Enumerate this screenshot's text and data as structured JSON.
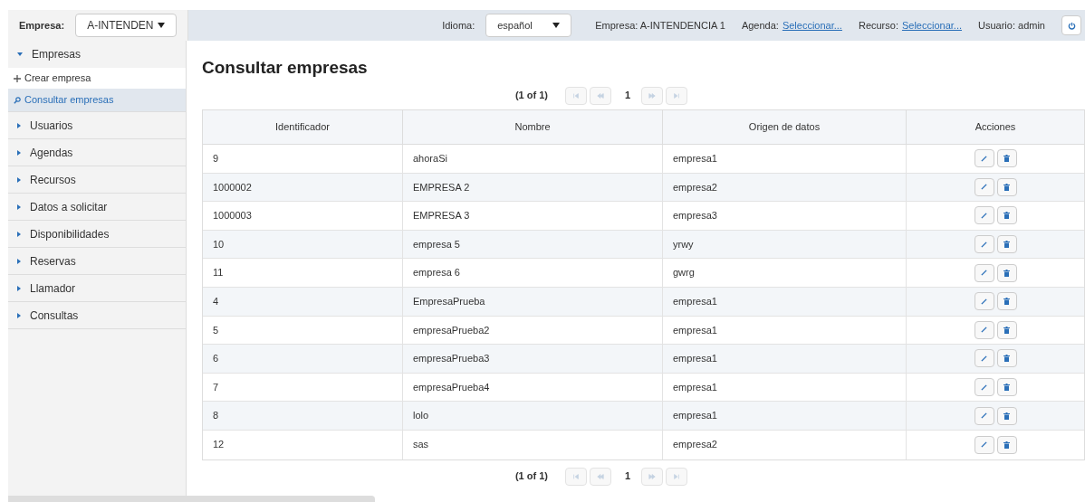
{
  "topbar": {
    "empresa_label": "Empresa:",
    "empresa_value": "A-INTENDEN",
    "idioma_label": "Idioma:",
    "idioma_value": "español",
    "empresa_info": "Empresa: A-INTENDENCIA 1",
    "agenda_label": "Agenda:",
    "agenda_link": "Seleccionar...",
    "recurso_label": "Recurso:",
    "recurso_link": "Seleccionar...",
    "usuario": "Usuario: admin"
  },
  "sidebar": {
    "items": [
      {
        "label": "Empresas",
        "expanded": true,
        "children": [
          {
            "label": "Crear empresa",
            "kind": "create",
            "selected": false
          },
          {
            "label": "Consultar empresas",
            "kind": "search",
            "selected": true
          }
        ]
      },
      {
        "label": "Usuarios",
        "expanded": false
      },
      {
        "label": "Agendas",
        "expanded": false
      },
      {
        "label": "Recursos",
        "expanded": false
      },
      {
        "label": "Datos a solicitar",
        "expanded": false
      },
      {
        "label": "Disponibilidades",
        "expanded": false
      },
      {
        "label": "Reservas",
        "expanded": false
      },
      {
        "label": "Llamador",
        "expanded": false
      },
      {
        "label": "Consultas",
        "expanded": false
      }
    ]
  },
  "page_title": "Consultar empresas",
  "paginators": [
    {
      "summary": "(1 of 1)",
      "page": "1"
    },
    {
      "summary": "(1 of 1)",
      "page": "1"
    }
  ],
  "table": {
    "columns": [
      "Identificador",
      "Nombre",
      "Origen de datos",
      "Acciones"
    ],
    "rows": [
      [
        "9",
        "ahoraSi",
        "empresa1"
      ],
      [
        "1000002",
        "EMPRESA 2",
        "empresa2"
      ],
      [
        "1000003",
        "EMPRESA 3",
        "empresa3"
      ],
      [
        "10",
        "empresa 5",
        "yrwy"
      ],
      [
        "11",
        "empresa 6",
        "gwrg"
      ],
      [
        "4",
        "EmpresaPrueba",
        "empresa1"
      ],
      [
        "5",
        "empresaPrueba2",
        "empresa1"
      ],
      [
        "6",
        "empresaPrueba3",
        "empresa1"
      ],
      [
        "7",
        "empresaPrueba4",
        "empresa1"
      ],
      [
        "8",
        "lolo",
        "empresa1"
      ],
      [
        "12",
        "sas",
        "empresa2"
      ]
    ]
  }
}
